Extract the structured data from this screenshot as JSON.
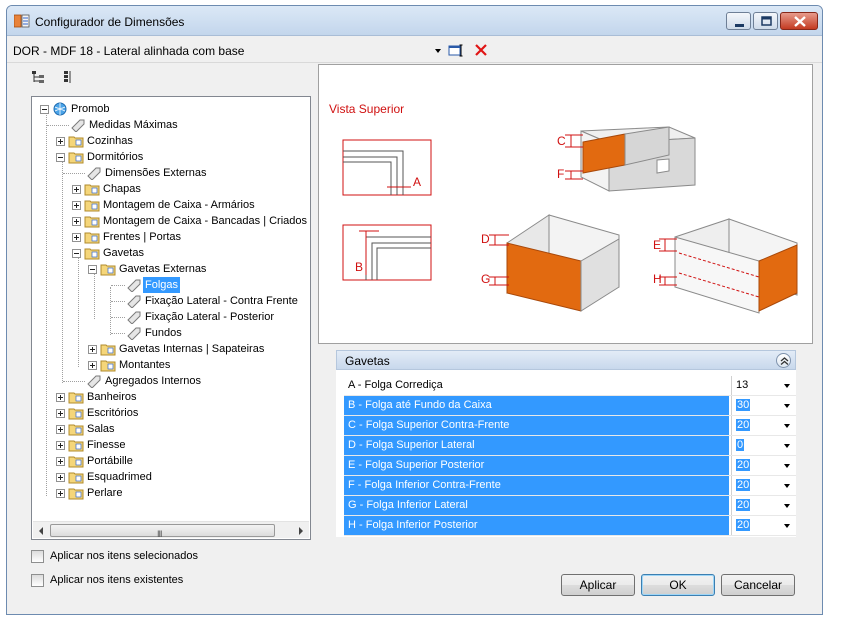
{
  "window": {
    "title": "Configurador de Dimensões",
    "minimize_icon": "minimize-icon",
    "maximize_icon": "maximize-icon",
    "close_icon": "close-icon"
  },
  "config_selector": {
    "value": "DOR - MDF 18 - Lateral alinhada com base"
  },
  "tree": {
    "items": [
      {
        "label": "Promob"
      },
      {
        "label": "Medidas Máximas"
      },
      {
        "label": "Cozinhas"
      },
      {
        "label": "Dormitórios"
      },
      {
        "label": "Dimensões Externas"
      },
      {
        "label": "Chapas"
      },
      {
        "label": "Montagem de Caixa - Armários"
      },
      {
        "label": "Montagem de Caixa - Bancadas | Criados"
      },
      {
        "label": "Frentes | Portas"
      },
      {
        "label": "Gavetas"
      },
      {
        "label": "Gavetas Externas"
      },
      {
        "label": "Folgas"
      },
      {
        "label": "Fixação Lateral - Contra Frente"
      },
      {
        "label": "Fixação Lateral - Posterior"
      },
      {
        "label": "Fundos"
      },
      {
        "label": "Gavetas Internas | Sapateiras"
      },
      {
        "label": "Montantes"
      },
      {
        "label": "Agregados Internos"
      },
      {
        "label": "Banheiros"
      },
      {
        "label": "Escritórios"
      },
      {
        "label": "Salas"
      },
      {
        "label": "Finesse"
      },
      {
        "label": "Portábille"
      },
      {
        "label": "Esquadrimed"
      },
      {
        "label": "Perlare"
      }
    ],
    "scroll_grip": "III"
  },
  "preview": {
    "view_label": "Vista Superior",
    "letters": {
      "a": "A",
      "b": "B",
      "c": "C",
      "d": "D",
      "e": "E",
      "f": "F",
      "g": "G",
      "h": "H"
    },
    "accent": "#e26a10",
    "red": "#d01010"
  },
  "properties": {
    "section_title": "Gavetas",
    "rows": [
      {
        "name": "A - Folga Corrediça",
        "value": "13"
      },
      {
        "name": "B - Folga até Fundo da Caixa",
        "value": "30"
      },
      {
        "name": "C - Folga Superior Contra-Frente",
        "value": "20"
      },
      {
        "name": "D - Folga Superior Lateral",
        "value": "0"
      },
      {
        "name": "E - Folga Superior Posterior",
        "value": "20"
      },
      {
        "name": "F - Folga Inferior Contra-Frente",
        "value": "20"
      },
      {
        "name": "G - Folga Inferior Lateral",
        "value": "20"
      },
      {
        "name": "H - Folga Inferior Posterior",
        "value": "20"
      }
    ]
  },
  "options": {
    "apply_selected": "Aplicar nos itens selecionados",
    "apply_existing": "Aplicar nos itens existentes"
  },
  "buttons": {
    "apply": "Aplicar",
    "ok": "OK",
    "cancel": "Cancelar"
  },
  "colors": {
    "selection": "#3399ff",
    "titlebar": "#c3d6ec"
  }
}
